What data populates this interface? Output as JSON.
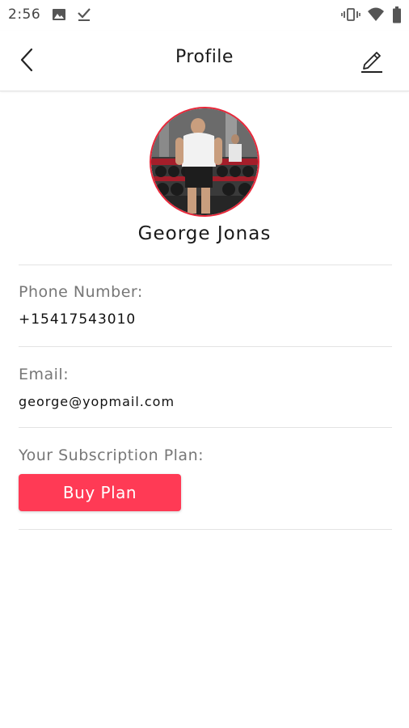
{
  "status_bar": {
    "time": "2:56",
    "icons": [
      "image-icon",
      "download-done-icon",
      "vibrate-icon",
      "wifi-icon",
      "battery-icon"
    ]
  },
  "app_bar": {
    "title": "Profile",
    "back_icon": "chevron-left-icon",
    "edit_icon": "pencil-icon"
  },
  "profile": {
    "name": "George Jonas",
    "avatar_border_color": "#e8283a"
  },
  "fields": {
    "phone_label": "Phone Number:",
    "phone_value": "+15417543010",
    "email_label": "Email:",
    "email_value": "george@yopmail.com",
    "subscription_label": "Your Subscription Plan:"
  },
  "actions": {
    "buy_plan_label": "Buy Plan",
    "buy_plan_color": "#ff3a55"
  }
}
